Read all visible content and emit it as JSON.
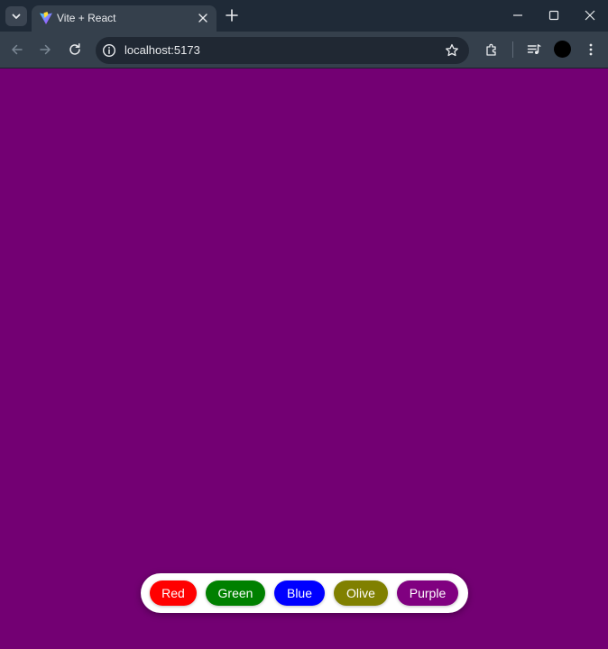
{
  "tab": {
    "title": "Vite + React"
  },
  "address_bar": {
    "url": "localhost:5173"
  },
  "page": {
    "background": "#730073",
    "buttons": [
      {
        "label": "Red",
        "color": "#ff0000"
      },
      {
        "label": "Green",
        "color": "#008000"
      },
      {
        "label": "Blue",
        "color": "#0000ff"
      },
      {
        "label": "Olive",
        "color": "#808000"
      },
      {
        "label": "Purple",
        "color": "#800080"
      }
    ]
  },
  "icons": {
    "tab_search": "chevron-down-icon",
    "favicon": "vite-logo-icon",
    "tab_close": "close-icon",
    "new_tab": "plus-icon",
    "back": "arrow-left-icon",
    "forward": "arrow-right-icon",
    "reload": "reload-icon",
    "site_info": "info-icon",
    "bookmark": "star-icon",
    "extensions": "puzzle-icon",
    "media": "media-control-icon",
    "menu": "kebab-menu-icon"
  }
}
